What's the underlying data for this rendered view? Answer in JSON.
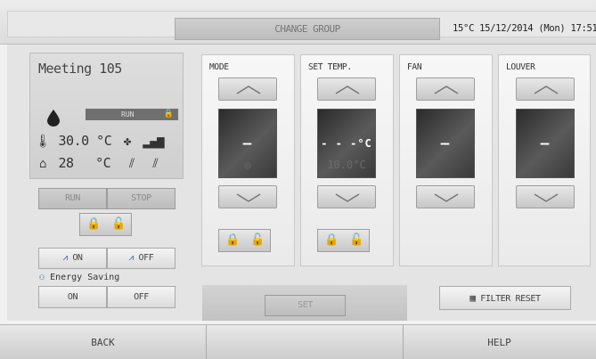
{
  "header": {
    "change_group_label": "CHANGE GROUP",
    "datetime": "15°C  15/12/2014 (Mon) 17:51"
  },
  "status": {
    "name": "Meeting 105",
    "run_state": "RUN",
    "room_temp": "30.0 °C",
    "outdoor_temp": "28",
    "outdoor_unit": "°C"
  },
  "controls": {
    "run_label": "RUN",
    "stop_label": "STOP",
    "ecosave_on_label": "ON",
    "ecosave_off_label": "OFF",
    "energy_saving_label": "Energy Saving",
    "energy_on_label": "ON",
    "energy_off_label": "OFF"
  },
  "columns": [
    {
      "title": "MODE",
      "value": "—",
      "ghost": "◎"
    },
    {
      "title": "SET TEMP.",
      "value": "- - -°C",
      "ghost": "10.0°C"
    },
    {
      "title": "FAN",
      "value": "—",
      "ghost": ""
    },
    {
      "title": "LOUVER",
      "value": "—",
      "ghost": ""
    }
  ],
  "actions": {
    "set_label": "SET",
    "filter_reset_label": "FILTER RESET"
  },
  "footer": {
    "back_label": "BACK",
    "help_label": "HELP"
  },
  "colors": {
    "display_bg": "#3a3a3a",
    "button_bg": "#c8c8c8"
  }
}
